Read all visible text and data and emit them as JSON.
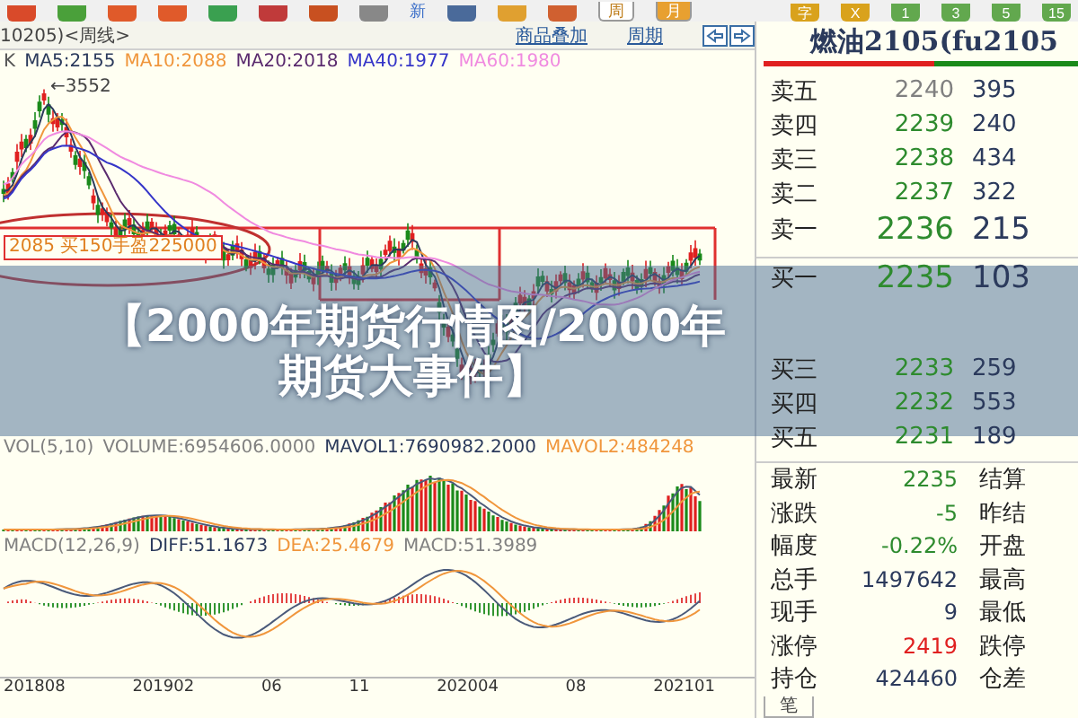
{
  "toolbar": {
    "new_label": "新",
    "period_buttons": [
      {
        "label": "周",
        "selected": true
      },
      {
        "label": "月",
        "selected": false
      }
    ],
    "quick_buttons": [
      {
        "label": "字",
        "color": "#d9a21c"
      },
      {
        "label": "X",
        "color": "#d9a21c"
      },
      {
        "label": "1",
        "color": "#62a84e"
      },
      {
        "label": "3",
        "color": "#62a84e"
      },
      {
        "label": "5",
        "color": "#62a84e"
      },
      {
        "label": "15",
        "color": "#62a84e"
      }
    ]
  },
  "chart_header": {
    "title": "10205)<周线>",
    "links": [
      "商品叠加",
      "周期"
    ]
  },
  "price_chart": {
    "legend": [
      {
        "text": "K",
        "color": "#555555"
      },
      {
        "text": "MA5:2155",
        "color": "#2b3a5c"
      },
      {
        "text": "MA10:2088",
        "color": "#f0963c"
      },
      {
        "text": "MA20:2018",
        "color": "#5a2a6e"
      },
      {
        "text": "MA40:1977",
        "color": "#3535c8"
      },
      {
        "text": "MA60:1980",
        "color": "#f08ae0"
      }
    ],
    "peak_label": "←3552",
    "trade_note": "2085 买150手盈225000"
  },
  "volume_chart": {
    "legend": [
      {
        "text": "VOL(5,10)",
        "color": "#808080"
      },
      {
        "text": "VOLUME:6954606.0000",
        "color": "#808080"
      },
      {
        "text": "MAVOL1:7690982.2000",
        "color": "#2b3a5c"
      },
      {
        "text": "MAVOL2:484248",
        "color": "#f0963c"
      }
    ]
  },
  "macd_chart": {
    "legend": [
      {
        "text": "MACD(12,26,9)",
        "color": "#808080"
      },
      {
        "text": "DIFF:51.1673",
        "color": "#2b3a5c"
      },
      {
        "text": "DEA:25.4679",
        "color": "#f0963c"
      },
      {
        "text": "MACD:51.3989",
        "color": "#808080"
      }
    ]
  },
  "date_axis": [
    "201808",
    "201902",
    "06",
    "11",
    "202004",
    "08",
    "202101"
  ],
  "quote": {
    "title": "燃油2105(fu2105",
    "sell": [
      {
        "label": "卖五",
        "price": "2240",
        "volume": "395",
        "color": "#808080"
      },
      {
        "label": "卖四",
        "price": "2239",
        "volume": "240",
        "color": "#2e8b2e"
      },
      {
        "label": "卖三",
        "price": "2238",
        "volume": "434",
        "color": "#2e8b2e"
      },
      {
        "label": "卖二",
        "price": "2237",
        "volume": "322",
        "color": "#2e8b2e"
      },
      {
        "label": "卖一",
        "price": "2236",
        "volume": "215",
        "color": "#2e8b2e"
      }
    ],
    "buy": [
      {
        "label": "买一",
        "price": "2235",
        "volume": "103",
        "color": "#2e8b2e"
      },
      {
        "label": "买三",
        "price": "2233",
        "volume": "259",
        "color": "#2e8b2e"
      },
      {
        "label": "买四",
        "price": "2232",
        "volume": "553",
        "color": "#2e8b2e"
      },
      {
        "label": "买五",
        "price": "2231",
        "volume": "189",
        "color": "#2e8b2e"
      }
    ],
    "stats": [
      {
        "label": "最新",
        "value": "2235",
        "color": "#2e8b2e",
        "field": "结算"
      },
      {
        "label": "涨跌",
        "value": "-5",
        "color": "#2e8b2e",
        "field": "昨结"
      },
      {
        "label": "幅度",
        "value": "-0.22%",
        "color": "#2e8b2e",
        "field": "开盘"
      },
      {
        "label": "总手",
        "value": "1497642",
        "color": "#2b3a5c",
        "field": "最高"
      },
      {
        "label": "现手",
        "value": "9",
        "color": "#2b3a5c",
        "field": "最低"
      },
      {
        "label": "涨停",
        "value": "2419",
        "color": "#e02020",
        "field": "跌停"
      },
      {
        "label": "持仓",
        "value": "424460",
        "color": "#2b3a5c",
        "field": "仓差"
      }
    ],
    "tab": "笔"
  },
  "banner": {
    "title": "【2000年期货行情图/2000年期货大事件】"
  }
}
